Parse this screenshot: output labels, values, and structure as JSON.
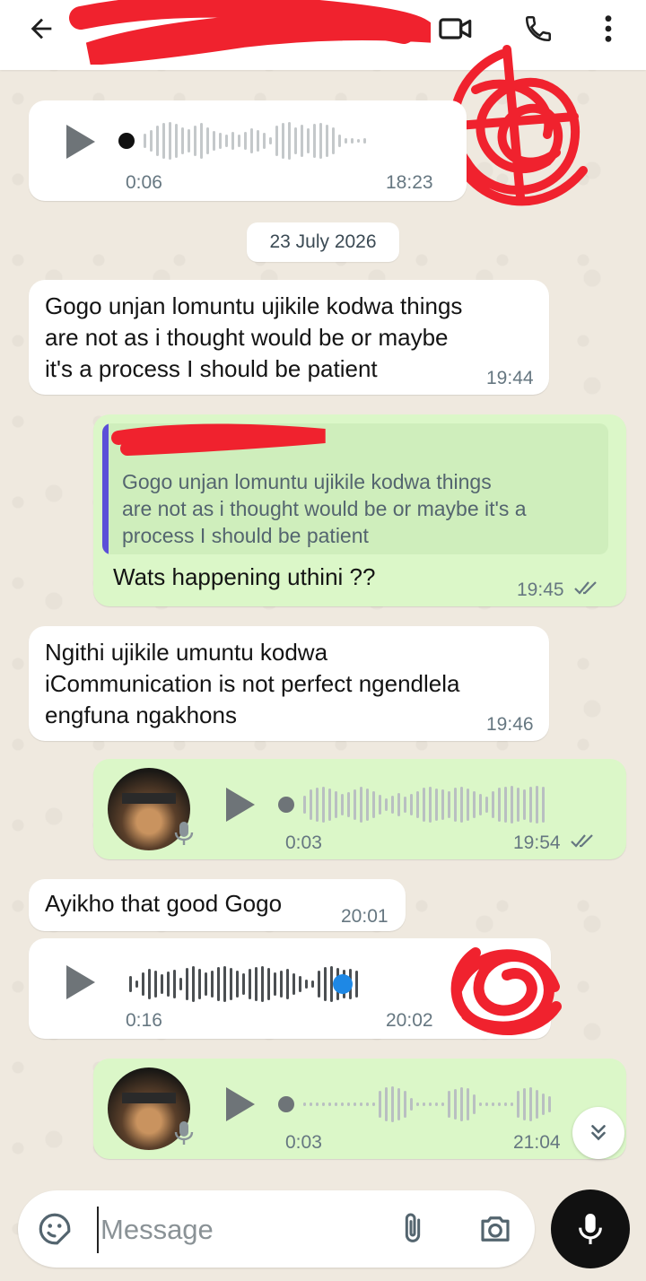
{
  "header": {
    "back_icon": "arrow-left-icon",
    "video_icon": "video-call-icon",
    "call_icon": "phone-icon",
    "menu_icon": "more-vert-icon",
    "background_color": "#ffffff"
  },
  "date_separator": "23 July 2026",
  "messages": [
    {
      "type": "voice",
      "direction": "in",
      "duration": "0:06",
      "time": "18:23"
    },
    {
      "type": "text",
      "direction": "in",
      "lines": [
        "Gogo unjan lomuntu ujikile kodwa things",
        "are not as i thought would be or maybe",
        "it's a process I should be patient"
      ],
      "time": "19:44"
    },
    {
      "type": "reply",
      "direction": "out",
      "quoted_lines": [
        "Gogo unjan lomuntu ujikile kodwa things",
        "are not as i thought would be or maybe it's a",
        "process I should be patient"
      ],
      "text": "Wats happening uthini ??",
      "time": "19:45",
      "status": "read"
    },
    {
      "type": "text",
      "direction": "in",
      "lines": [
        "Ngithi ujikile umuntu kodwa",
        "iCommunication is not perfect ngendlela",
        "engfuna ngakhons"
      ],
      "time": "19:46"
    },
    {
      "type": "voice",
      "direction": "out",
      "duration": "0:03",
      "time": "19:54",
      "status": "read"
    },
    {
      "type": "text",
      "direction": "in",
      "lines": [
        "Ayikho that good Gogo"
      ],
      "time": "20:01"
    },
    {
      "type": "voice",
      "direction": "in",
      "duration": "0:16",
      "time": "20:02",
      "progress": 0.92
    },
    {
      "type": "voice",
      "direction": "out",
      "duration": "0:03",
      "time": "21:04"
    }
  ],
  "composer": {
    "placeholder": "Message",
    "emoji_icon": "sticker-icon",
    "attach_icon": "paperclip-icon",
    "camera_icon": "camera-icon",
    "mic_icon": "microphone-icon"
  },
  "colors": {
    "incoming_bubble": "#ffffff",
    "outgoing_bubble": "#dbf7c8",
    "read_ticks": "#667781",
    "voice_progress": "#1e88e5",
    "quote_accent": "#5b4fd8"
  }
}
